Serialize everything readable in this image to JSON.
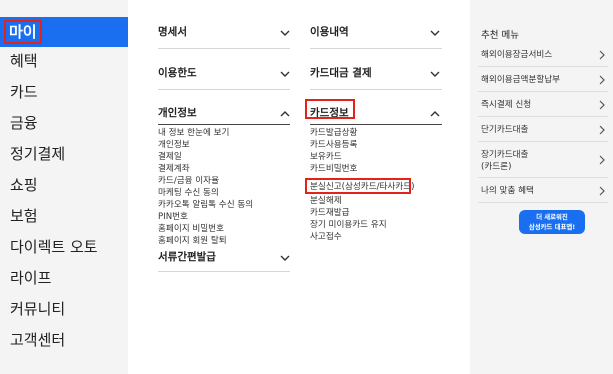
{
  "left_nav": {
    "items": [
      "마이",
      "혜택",
      "카드",
      "금융",
      "정기결제",
      "쇼핑",
      "보험",
      "다이렉트 오토",
      "라이프",
      "커뮤니티",
      "고객센터"
    ]
  },
  "menu": {
    "col1": {
      "statement": "명세서",
      "limit": "이용한도",
      "personal_info": "개인정보",
      "personal_items": [
        "내 정보 한눈에 보기",
        "개인정보",
        "결제일",
        "결제계좌",
        "카드/금융 이자율",
        "마케팅 수신 동의",
        "카카오톡 알림톡 수신 동의",
        "PIN번호",
        "홈페이지 비밀번호",
        "홈페이지 회원 탈퇴"
      ],
      "documents": "서류간편발급"
    },
    "col2": {
      "usage": "이용내역",
      "card_payment": "카드대금 결제",
      "card_info": "카드정보",
      "card_items": [
        "카드발급상황",
        "카드사용등록",
        "보유카드",
        "카드비밀번호",
        "분실신고(삼성카드/타사카드)",
        "분실해제",
        "카드재발급",
        "장기 미이용카드 유지",
        "사고접수"
      ]
    }
  },
  "recommend": {
    "title": "추천 메뉴",
    "items": [
      "해외이용장금서비스",
      "해외이용금액분할납부",
      "즉시결제 신청",
      "단기카드대출",
      "장기카드대출\n(카드론)",
      "나의 맞춤 혜택"
    ]
  },
  "promo": {
    "bubble_line1": "더 새로워진",
    "bubble_line2": "삼성카드 대표앱!"
  },
  "colors": {
    "accent": "#1a6ff0",
    "highlight": "#e2231a",
    "panel_bg": "#f4f4f4"
  }
}
